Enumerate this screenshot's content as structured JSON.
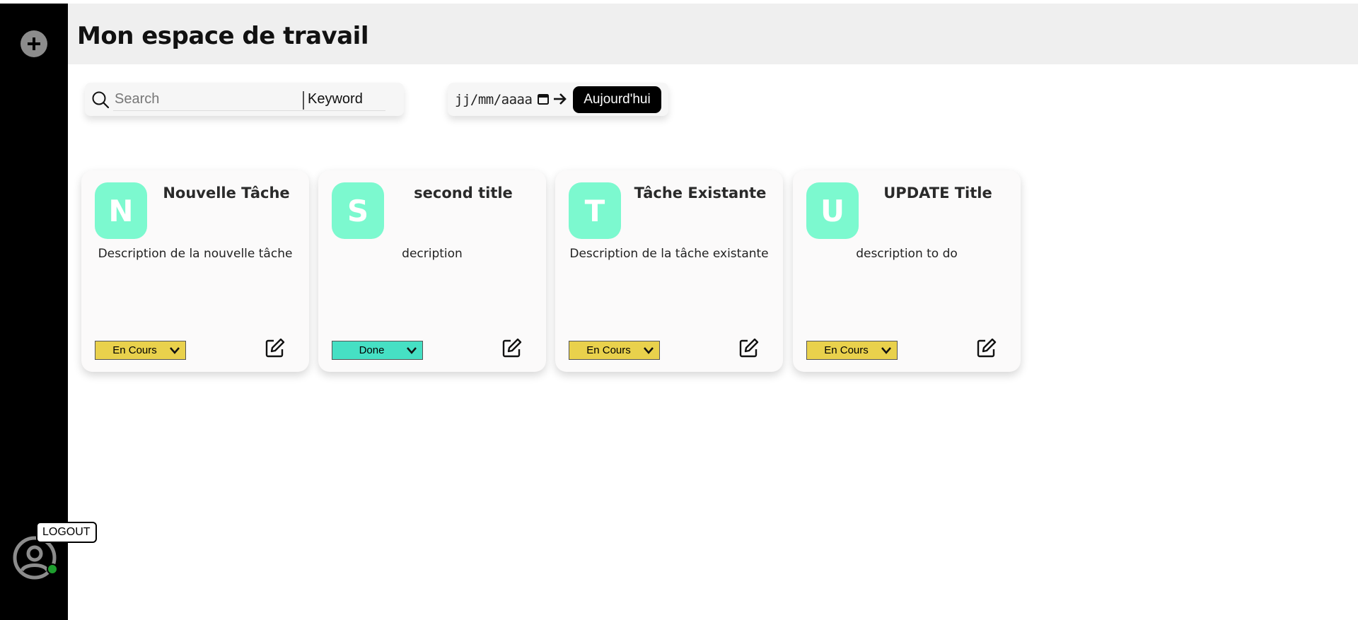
{
  "sidebar": {
    "add_icon": "plus-circle-icon",
    "user_icon": "user-circle-icon",
    "logout_label": "LOGOUT",
    "status_color": "#1e9e2e"
  },
  "header": {
    "title": "Mon espace de travail"
  },
  "search": {
    "placeholder": "Search",
    "filter_label": "Keyword"
  },
  "date_filter": {
    "placeholder": "jj/mm/aaaa",
    "today_label": "Aujourd'hui"
  },
  "cards": [
    {
      "initial": "N",
      "title": "Nouvelle Tâche",
      "description": "Description de la nouvelle tâche",
      "status": "En Cours",
      "status_color": "#e9d14c"
    },
    {
      "initial": "S",
      "title": "second title",
      "description": "decription",
      "status": "Done",
      "status_color": "#46e0c4"
    },
    {
      "initial": "T",
      "title": "Tâche Existante",
      "description": "Description de la tâche existante",
      "status": "En Cours",
      "status_color": "#e9d14c"
    },
    {
      "initial": "U",
      "title": "UPDATE Title",
      "description": "description to do",
      "status": "En Cours",
      "status_color": "#e9d14c"
    }
  ],
  "colors": {
    "sidebar_bg": "#000000",
    "header_bg": "#efefef",
    "avatar_bg": "#7cf9cf",
    "button_bg": "#000000"
  }
}
